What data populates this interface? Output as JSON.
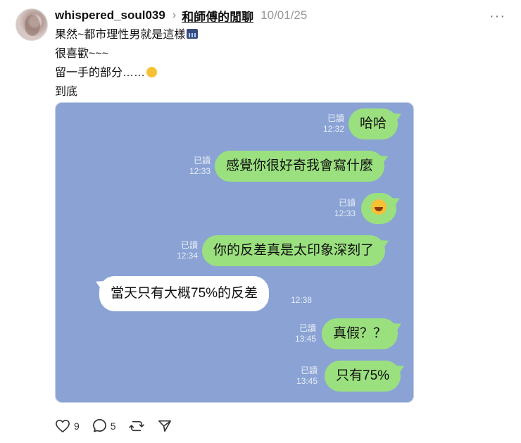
{
  "post": {
    "username": "whispered_soul039",
    "community": "和師傅的閒聊",
    "date": "10/01/25",
    "lines": [
      "果然~都市理性男就是這樣",
      "很喜歡~~~",
      "留一手的部分……",
      "到底"
    ]
  },
  "chat": {
    "messages": [
      {
        "side": "out",
        "text": "哈哈",
        "read": "已讀",
        "time": "12:32"
      },
      {
        "side": "out",
        "text": "感覺你很好奇我會寫什麼",
        "read": "已讀",
        "time": "12:33"
      },
      {
        "side": "out",
        "text": "",
        "emoji": "rolling-laughing-emoji",
        "read": "已讀",
        "time": "12:33"
      },
      {
        "side": "out",
        "text": "你的反差真是太印象深刻了",
        "read": "已讀",
        "time": "12:34"
      },
      {
        "side": "in",
        "text": "當天只有大概75%的反差",
        "time": "12:38"
      },
      {
        "side": "out",
        "text": "真假？？",
        "read": "已讀",
        "time": "13:45"
      },
      {
        "side": "out",
        "text": "只有75%",
        "read": "已讀",
        "time": "13:45"
      }
    ]
  },
  "actions": {
    "likes": "9",
    "comments": "5"
  },
  "icons": {
    "more": "more-dots-icon",
    "like": "heart-icon",
    "comment": "comment-bubble-icon",
    "repost": "repost-icon",
    "share": "send-icon"
  },
  "colors": {
    "chat_bg": "#8aa3d4",
    "outgoing_bubble": "#9be07f",
    "incoming_bubble": "#ffffff"
  }
}
